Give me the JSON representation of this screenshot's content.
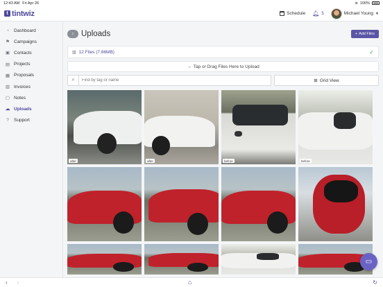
{
  "status_bar": {
    "time": "12:43 AM",
    "date": "Fri Apr 26",
    "battery": "100%"
  },
  "header": {
    "logo_text": "tintwiz",
    "schedule_label": "Schedule",
    "notification_count": "5",
    "user_name": "Michael Young"
  },
  "sidebar": {
    "items": [
      {
        "label": "Dashboard",
        "icon": "dashboard-icon",
        "active": false
      },
      {
        "label": "Campaigns",
        "icon": "campaigns-icon",
        "active": false
      },
      {
        "label": "Contacts",
        "icon": "contacts-icon",
        "active": false
      },
      {
        "label": "Projects",
        "icon": "projects-icon",
        "active": false
      },
      {
        "label": "Proposals",
        "icon": "proposals-icon",
        "active": false
      },
      {
        "label": "Invoices",
        "icon": "invoices-icon",
        "active": false
      },
      {
        "label": "Notes",
        "icon": "notes-icon",
        "active": false
      },
      {
        "label": "Uploads",
        "icon": "uploads-icon",
        "active": true
      },
      {
        "label": "Support",
        "icon": "support-icon",
        "active": false
      }
    ]
  },
  "main": {
    "title": "Uploads",
    "add_files_label": "Add Files",
    "files_summary": "12 Files (7.86MB)",
    "drop_zone_text": "Tap or Drag Files Here to Upload",
    "search_placeholder": "Find by tag or name",
    "grid_view_label": "Grid View",
    "photos": [
      {
        "tag": "after",
        "scene": "white car side"
      },
      {
        "tag": "after",
        "scene": "white car garage"
      },
      {
        "tag": "before",
        "scene": "white car door"
      },
      {
        "tag": "before",
        "scene": "white car front"
      },
      {
        "tag": "",
        "scene": "red car"
      },
      {
        "tag": "",
        "scene": "red car"
      },
      {
        "tag": "",
        "scene": "red car"
      },
      {
        "tag": "",
        "scene": "red car top"
      },
      {
        "tag": "",
        "scene": "red car"
      },
      {
        "tag": "",
        "scene": "red car"
      },
      {
        "tag": "",
        "scene": "white car"
      },
      {
        "tag": "",
        "scene": "red car"
      }
    ]
  },
  "colors": {
    "accent": "#4e4a9e",
    "button": "#5a55a6",
    "success": "#28a745",
    "chat": "#6a63c4"
  }
}
